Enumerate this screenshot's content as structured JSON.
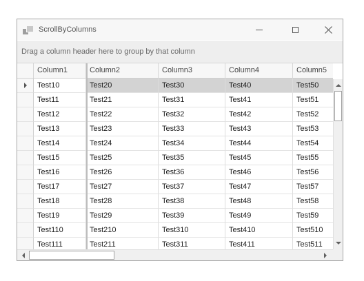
{
  "window": {
    "title": "ScrollByColumns",
    "icon": "app-grid-icon",
    "controls": [
      "minimize-icon",
      "maximize-icon",
      "close-icon"
    ]
  },
  "group_panel": {
    "text": "Drag a column header here to group by that column"
  },
  "grid": {
    "columns": [
      "Column1",
      "Column2",
      "Column3",
      "Column4",
      "Column5"
    ],
    "rows": [
      [
        "Test10",
        "Test20",
        "Test30",
        "Test40",
        "Test50"
      ],
      [
        "Test11",
        "Test21",
        "Test31",
        "Test41",
        "Test51"
      ],
      [
        "Test12",
        "Test22",
        "Test32",
        "Test42",
        "Test52"
      ],
      [
        "Test13",
        "Test23",
        "Test33",
        "Test43",
        "Test53"
      ],
      [
        "Test14",
        "Test24",
        "Test34",
        "Test44",
        "Test54"
      ],
      [
        "Test15",
        "Test25",
        "Test35",
        "Test45",
        "Test55"
      ],
      [
        "Test16",
        "Test26",
        "Test36",
        "Test46",
        "Test56"
      ],
      [
        "Test17",
        "Test27",
        "Test37",
        "Test47",
        "Test57"
      ],
      [
        "Test18",
        "Test28",
        "Test38",
        "Test48",
        "Test58"
      ],
      [
        "Test19",
        "Test29",
        "Test39",
        "Test49",
        "Test59"
      ],
      [
        "Test110",
        "Test210",
        "Test310",
        "Test410",
        "Test510"
      ],
      [
        "Test111",
        "Test211",
        "Test311",
        "Test411",
        "Test511"
      ]
    ],
    "focused_row": 0,
    "frozen_columns": 1
  },
  "colors": {
    "selected_row": "#d3d3d3",
    "header_bg": "#f7f7f7",
    "group_panel_bg": "#eeeeee",
    "border": "#a6a6a6"
  }
}
